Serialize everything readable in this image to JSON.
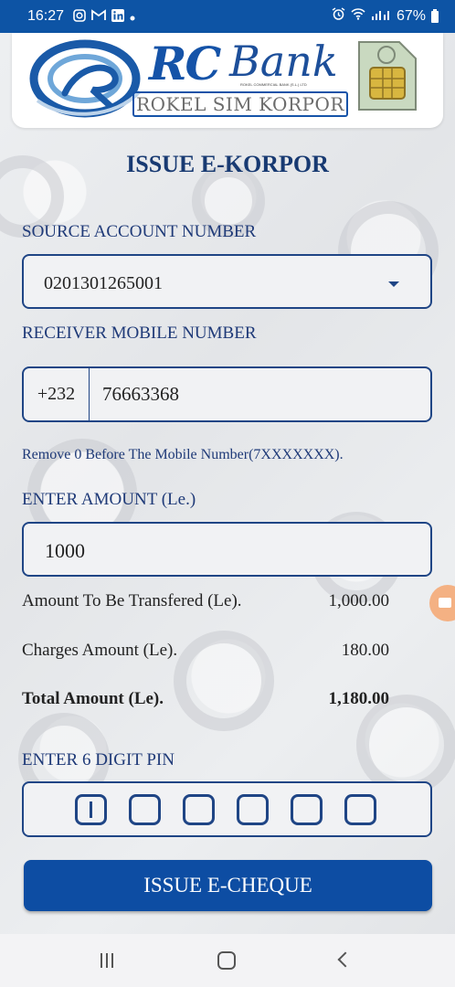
{
  "status_bar": {
    "time": "16:27",
    "icons_left": [
      "instagram-icon",
      "gmail-icon",
      "linkedin-icon",
      "dot-icon"
    ],
    "icons_right": [
      "alarm-icon",
      "wifi-icon",
      "signal-icon"
    ],
    "battery": "67%"
  },
  "logo": {
    "brand_rc": "RC",
    "brand_bank": "Bank",
    "tagline": "ROKEL SIM KORPOR",
    "small_text": "ROKEL COMMERCIAL BANK (S.L.) LTD"
  },
  "page": {
    "title": "ISSUE E-KORPOR"
  },
  "form": {
    "source_account_label": "SOURCE ACCOUNT NUMBER",
    "source_account_value": "0201301265001",
    "receiver_label": "RECEIVER MOBILE NUMBER",
    "country_code": "+232",
    "receiver_number": "76663368",
    "hint": "Remove 0 Before The Mobile Number(7XXXXXXX).",
    "amount_label": "ENTER AMOUNT (Le.)",
    "amount_value": "1000",
    "pin_label": "ENTER 6 DIGIT PIN",
    "pin_digits": 6
  },
  "summary": {
    "transfer_label": "Amount To Be Transfered (Le).",
    "transfer_value": "1,000.00",
    "charges_label": "Charges Amount (Le).",
    "charges_value": "180.00",
    "total_label": "Total Amount (Le).",
    "total_value": "1,180.00"
  },
  "actions": {
    "issue_button": "ISSUE E-CHEQUE"
  },
  "colors": {
    "status_bar": "#0d54a5",
    "primary": "#0d4da3",
    "label": "#1f3a78",
    "floating_button": "#f4b183"
  }
}
